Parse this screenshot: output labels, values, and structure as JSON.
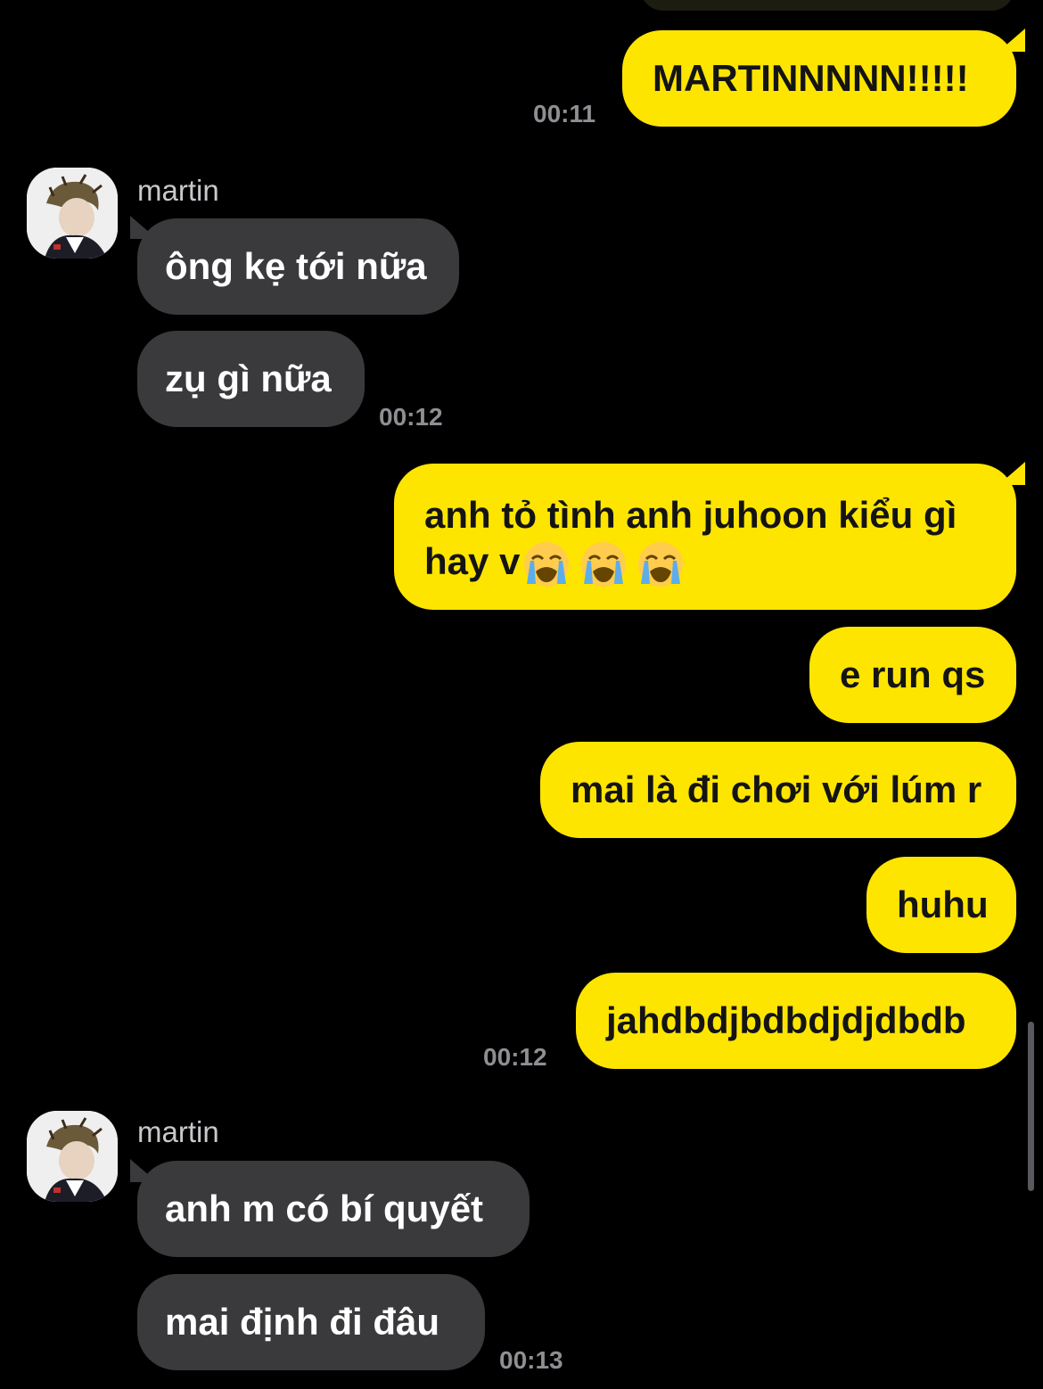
{
  "colors": {
    "background": "#000000",
    "outgoing_bubble": "#FEE500",
    "incoming_bubble": "#3A3A3C",
    "timestamp": "#8E8E93"
  },
  "messages": [
    {
      "direction": "out",
      "text": "MARTINNNNN!!!!!",
      "time": "00:11"
    },
    {
      "direction": "in",
      "sender": "martin",
      "text": "ông kẹ tới nữa"
    },
    {
      "direction": "in",
      "text": "zụ gì nữa",
      "time": "00:12"
    },
    {
      "direction": "out",
      "line1": "anh tỏ tình anh juhoon kiểu gì",
      "line2": "hay v",
      "emoji": "loudly-crying-face x3"
    },
    {
      "direction": "out",
      "text": "e run qs"
    },
    {
      "direction": "out",
      "text": "mai là đi chơi với lúm r"
    },
    {
      "direction": "out",
      "text": "huhu"
    },
    {
      "direction": "out",
      "text": "jahdbdjbdbdjdjdbdb",
      "time": "00:12"
    },
    {
      "direction": "in",
      "sender": "martin",
      "text": "anh m có bí quyết"
    },
    {
      "direction": "in",
      "text": "mai định đi đâu",
      "time": "00:13"
    }
  ]
}
